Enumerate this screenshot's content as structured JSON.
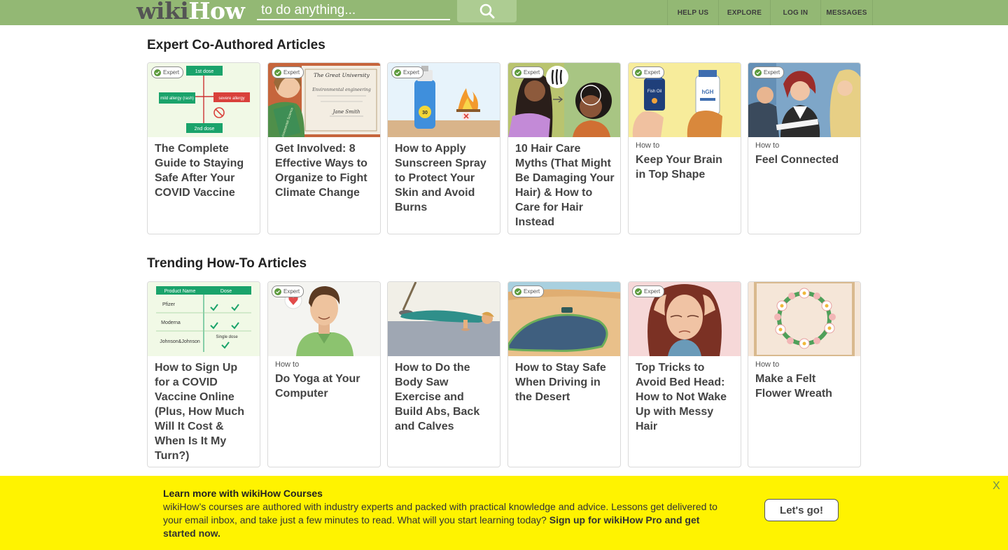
{
  "header": {
    "logo_part1": "wiki",
    "logo_part2": "How",
    "search_placeholder": "to do anything...",
    "nav": [
      "HELP US",
      "EXPLORE",
      "LOG IN",
      "MESSAGES"
    ],
    "background": "#93b874"
  },
  "sections": [
    {
      "title": "Expert Co-Authored Articles",
      "cards": [
        {
          "expert": true,
          "howto": "",
          "title": "The Complete Guide to Staying Safe After Your COVID Vaccine"
        },
        {
          "expert": true,
          "howto": "",
          "title": "Get Involved: 8 Effective Ways to Organize to Fight Climate Change"
        },
        {
          "expert": true,
          "howto": "",
          "title": "How to Apply Sunscreen Spray to Protect Your Skin and Avoid Burns"
        },
        {
          "expert": true,
          "howto": "",
          "title": "10 Hair Care Myths (That Might Be Damaging Your Hair) & How to Care for Hair Instead"
        },
        {
          "expert": true,
          "howto": "How to",
          "title": "Keep Your Brain in Top Shape"
        },
        {
          "expert": true,
          "howto": "How to",
          "title": "Feel Connected"
        }
      ]
    },
    {
      "title": "Trending How-To Articles",
      "cards": [
        {
          "expert": false,
          "howto": "",
          "title": "How to Sign Up for a COVID Vaccine Online (Plus, How Much Will It Cost & When Is It My Turn?)"
        },
        {
          "expert": true,
          "howto": "How to",
          "title": "Do Yoga at Your Computer"
        },
        {
          "expert": false,
          "howto": "",
          "title": "How to Do the Body Saw Exercise and Build Abs, Back and Calves"
        },
        {
          "expert": true,
          "howto": "",
          "title": "How to Stay Safe When Driving in the Desert"
        },
        {
          "expert": true,
          "howto": "",
          "title": "Top Tricks to Avoid Bed Head: How to Not Wake Up with Messy Hair"
        },
        {
          "expert": false,
          "howto": "How to",
          "title": "Make a Felt Flower Wreath"
        }
      ]
    }
  ],
  "badge_label": "Expert",
  "thumb_text": {
    "dose_1": "1st dose",
    "dose_2": "2nd dose",
    "mild_allergy": "mild allergy (rash)",
    "severe_allergy": "severe allergy",
    "university": "The Great University",
    "degree_line": "Environmental engineering",
    "cert_name": "Jane Smith",
    "book_label": "Environmental Science",
    "fish_oil": "Fish Oil",
    "hgh": "hGH",
    "table_col1": "Product Name",
    "table_col2": "Dose",
    "product_1": "Pfizer",
    "product_2": "Moderna",
    "product_3": "Johnson&Johnson",
    "single_dose": "Single dose",
    "spf": "30"
  },
  "banner": {
    "title": "Learn more with wikiHow Courses",
    "text": "wikiHow’s courses are authored with industry experts and packed with practical knowledge and advice. Lessons get delivered to your email inbox, and take just a few minutes to read. What will you start learning today?",
    "text_bold": "Sign up for wikiHow Pro and get started now.",
    "cta": "Let's go!",
    "close": "X",
    "background": "#fff300"
  }
}
